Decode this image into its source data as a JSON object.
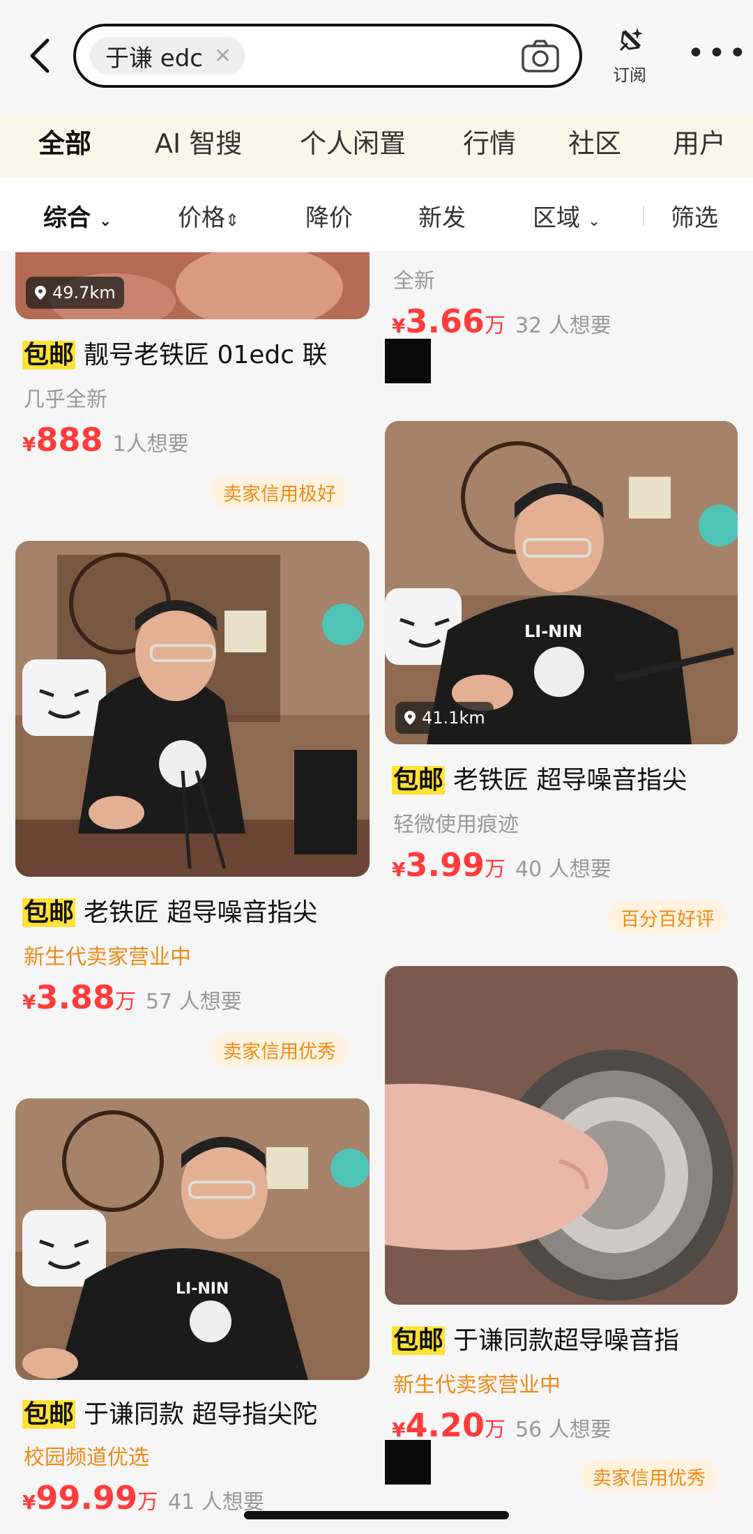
{
  "search": {
    "query": "于谦 edc",
    "subscribe_label": "订阅"
  },
  "categories": [
    "全部",
    "AI 智搜",
    "个人闲置",
    "行情",
    "社区",
    "用户"
  ],
  "filters": [
    "综合",
    "价格",
    "降价",
    "新发",
    "区域",
    "筛选"
  ],
  "items": [
    {
      "distance": "49.7km",
      "tag": "包邮",
      "title": "靓号老铁匠 01edc 联",
      "condition": "几乎全新",
      "currency": "¥",
      "price": "888",
      "unit": "",
      "want": "1人想要",
      "badge": "卖家信用极好"
    },
    {
      "condition": "全新",
      "currency": "¥",
      "price": "3.66",
      "unit": "万",
      "want": "32 人想要"
    },
    {
      "distance": "41.1km",
      "tag": "包邮",
      "title": "老铁匠 超导噪音指尖",
      "condition": "轻微使用痕迹",
      "currency": "¥",
      "price": "3.99",
      "unit": "万",
      "want": "40 人想要",
      "badge": "百分百好评"
    },
    {
      "tag": "包邮",
      "title": "老铁匠 超导噪音指尖",
      "condition": "新生代卖家营业中",
      "currency": "¥",
      "price": "3.88",
      "unit": "万",
      "want": "57 人想要",
      "badge": "卖家信用优秀"
    },
    {
      "tag": "包邮",
      "title": "于谦同款超导噪音指",
      "condition": "新生代卖家营业中",
      "currency": "¥",
      "price": "4.20",
      "unit": "万",
      "want": "56 人想要",
      "badge": "卖家信用优秀"
    },
    {
      "tag": "包邮",
      "title": "于谦同款 超导指尖陀",
      "condition": "校园频道优选",
      "currency": "¥",
      "price": "99.99",
      "unit": "万",
      "want": "41 人想要"
    }
  ]
}
